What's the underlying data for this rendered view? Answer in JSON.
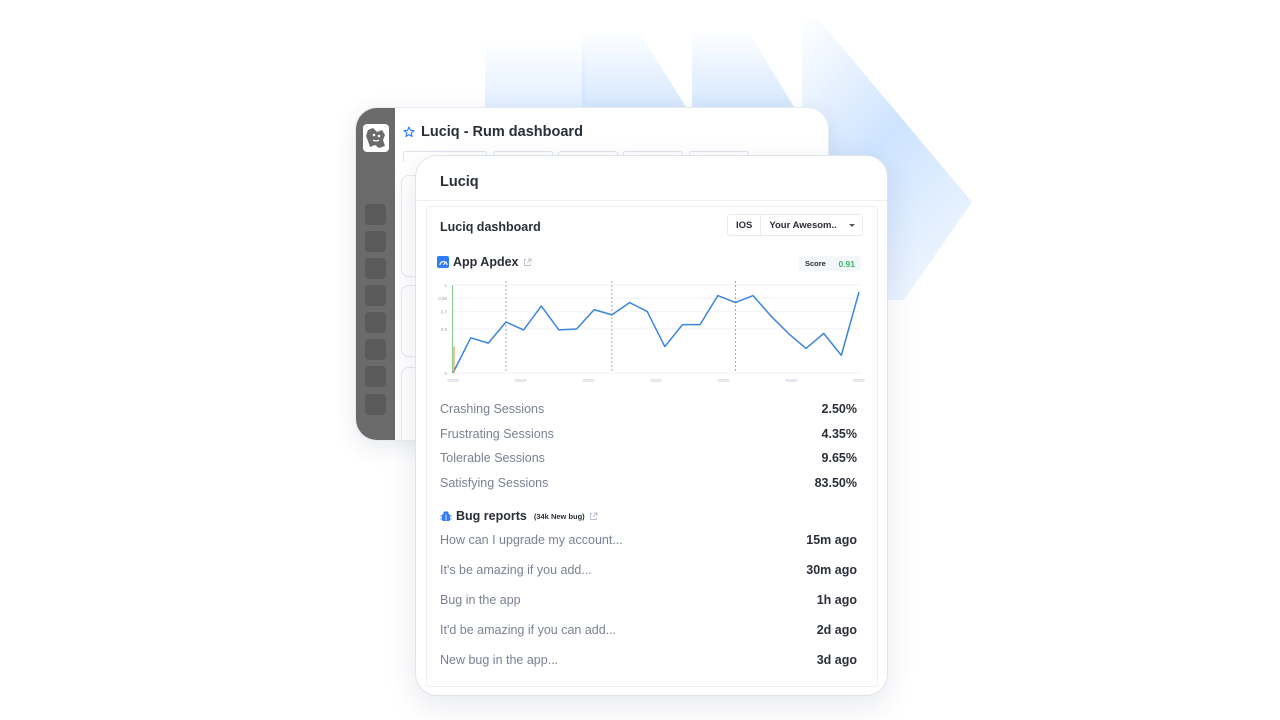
{
  "colors": {
    "accent": "#2f7cf6",
    "line": "#3b86d9",
    "score_green": "#35b96b",
    "sidebar_bg": "#6b6b6b"
  },
  "back_window": {
    "title": "Luciq - Rum dashboard",
    "star_icon": "star-outline-icon",
    "logo_icon": "dog-logo-icon"
  },
  "panel": {
    "title": "Luciq",
    "dashboard_title": "Luciq dashboard",
    "platform": "IOS",
    "app": "Your Awesom.."
  },
  "apdex": {
    "title": "App Apdex",
    "score_label": "Score",
    "score_value": "0.91"
  },
  "chart_data": {
    "type": "line",
    "title": "App Apdex",
    "y_tick_labels": [
      "0",
      "0.5",
      "0.7",
      "0.85",
      "1"
    ],
    "ylim": [
      0,
      1
    ],
    "series": [
      {
        "values": [
          0,
          0.4,
          0.34,
          0.58,
          0.49,
          0.76,
          0.49,
          0.5,
          0.72,
          0.66,
          0.8,
          0.7,
          0.3,
          0.55,
          0.55,
          0.88,
          0.8,
          0.88,
          0.65,
          0.45,
          0.28,
          0.45,
          0.2,
          0.92
        ]
      }
    ],
    "vertical_markers_at_index": [
      3,
      9,
      16
    ],
    "grid": true
  },
  "metrics": [
    {
      "label": "Crashing Sessions",
      "value": "2.50%"
    },
    {
      "label": "Frustrating Sessions",
      "value": "4.35%"
    },
    {
      "label": "Tolerable Sessions",
      "value": "9.65%"
    },
    {
      "label": "Satisfying Sessions",
      "value": "83.50%"
    }
  ],
  "bug_reports": {
    "title": "Bug reports",
    "badge": "(34k New bug)",
    "items": [
      {
        "text": "How can I upgrade my account...",
        "time": "15m ago"
      },
      {
        "text": "It's be amazing if you add...",
        "time": "30m ago"
      },
      {
        "text": "Bug in the app",
        "time": "1h ago"
      },
      {
        "text": "It'd be amazing if you can add...",
        "time": "2d ago"
      },
      {
        "text": "New bug in the app...",
        "time": "3d ago"
      }
    ]
  }
}
